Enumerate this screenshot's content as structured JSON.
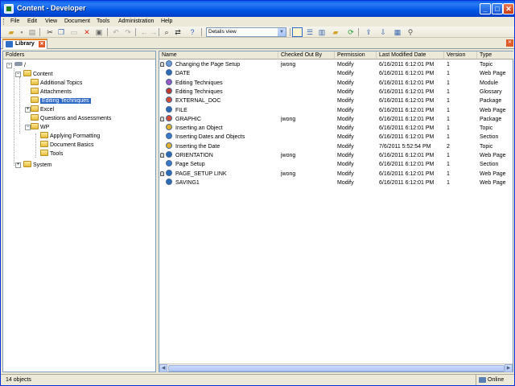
{
  "window": {
    "title": "Content - Developer",
    "minimize_glyph": "_",
    "maximize_glyph": "□",
    "close_glyph": "✕"
  },
  "menu": [
    "File",
    "Edit",
    "View",
    "Document",
    "Tools",
    "Administration",
    "Help"
  ],
  "toolbar": {
    "view_select_value": "Details view",
    "icons": [
      "open-folder-icon",
      "save-icon",
      "print-icon",
      "cut-icon",
      "copy-icon",
      "paste-icon",
      "delete-icon",
      "properties-icon",
      "undo-icon",
      "redo-icon",
      "back-icon",
      "forward-icon",
      "find-icon",
      "replace-icon",
      "help-icon",
      "details-view-icon",
      "list-view-icon",
      "split-view-icon",
      "new-folder-icon",
      "refresh-icon",
      "check-in-icon",
      "check-out-icon",
      "publish-icon",
      "link-icon"
    ]
  },
  "tab": {
    "label": "Library",
    "close_glyph": "✕"
  },
  "panel_close_glyph": "✕",
  "folders": {
    "header": "Folders",
    "root": "/",
    "items": [
      {
        "label": "Content",
        "level": 1,
        "expander": "−"
      },
      {
        "label": "Additional Topics",
        "level": 2,
        "expander": ""
      },
      {
        "label": "Attachments",
        "level": 2,
        "expander": ""
      },
      {
        "label": "Editing Techniques",
        "level": 2,
        "expander": "",
        "selected": true
      },
      {
        "label": "Excel",
        "level": 2,
        "expander": "+"
      },
      {
        "label": "Questions and Assessments",
        "level": 2,
        "expander": ""
      },
      {
        "label": "WP",
        "level": 2,
        "expander": "−"
      },
      {
        "label": "Applying Formatting",
        "level": 3,
        "expander": ""
      },
      {
        "label": "Document Basics",
        "level": 3,
        "expander": ""
      },
      {
        "label": "Tools",
        "level": 3,
        "expander": ""
      },
      {
        "label": "System",
        "level": 1,
        "expander": "+"
      }
    ]
  },
  "list": {
    "columns": [
      "Name",
      "Checked Out By",
      "Permission",
      "Last Modified Date",
      "Version",
      "Type"
    ],
    "rows": [
      {
        "locked": true,
        "icon": "topic-icon",
        "icon_color": "#6a9ad8",
        "name": "Changing the Page Setup",
        "checked_out_by": "jwong",
        "permission": "Modify",
        "modified": "6/16/2011 6:12:01 PM",
        "version": "1",
        "type": "Topic"
      },
      {
        "locked": false,
        "icon": "web-page-icon",
        "icon_color": "#2a6bb8",
        "name": "DATE",
        "checked_out_by": "",
        "permission": "Modify",
        "modified": "6/16/2011 6:12:01 PM",
        "version": "1",
        "type": "Web Page"
      },
      {
        "locked": false,
        "icon": "module-icon",
        "icon_color": "#9b59c6",
        "name": "Editing Techniques",
        "checked_out_by": "",
        "permission": "Modify",
        "modified": "6/16/2011 6:12:01 PM",
        "version": "1",
        "type": "Module"
      },
      {
        "locked": false,
        "icon": "glossary-icon",
        "icon_color": "#c0392b",
        "name": "Editing Techniques",
        "checked_out_by": "",
        "permission": "Modify",
        "modified": "6/16/2011 6:12:01 PM",
        "version": "1",
        "type": "Glossary"
      },
      {
        "locked": false,
        "icon": "package-icon",
        "icon_color": "#d04a3a",
        "name": "EXTERNAL_DOC",
        "checked_out_by": "",
        "permission": "Modify",
        "modified": "6/16/2011 6:12:01 PM",
        "version": "1",
        "type": "Package"
      },
      {
        "locked": false,
        "icon": "web-page-icon",
        "icon_color": "#2a6bb8",
        "name": "FILE",
        "checked_out_by": "",
        "permission": "Modify",
        "modified": "6/16/2011 6:12:01 PM",
        "version": "1",
        "type": "Web Page"
      },
      {
        "locked": true,
        "icon": "package-icon",
        "icon_color": "#d04a3a",
        "name": "GRAPHIC",
        "checked_out_by": "jwong",
        "permission": "Modify",
        "modified": "6/16/2011 6:12:01 PM",
        "version": "1",
        "type": "Package"
      },
      {
        "locked": false,
        "icon": "topic-icon",
        "icon_color": "#e0b030",
        "name": "Inserting an Object",
        "checked_out_by": "",
        "permission": "Modify",
        "modified": "6/16/2011 6:12:01 PM",
        "version": "1",
        "type": "Topic"
      },
      {
        "locked": false,
        "icon": "section-icon",
        "icon_color": "#3a78c8",
        "name": "Inserting Dates and Objects",
        "checked_out_by": "",
        "permission": "Modify",
        "modified": "6/16/2011 6:12:01 PM",
        "version": "1",
        "type": "Section"
      },
      {
        "locked": false,
        "icon": "topic-icon",
        "icon_color": "#e0b030",
        "name": "Inserting the Date",
        "checked_out_by": "",
        "permission": "Modify",
        "modified": "7/6/2011 5:52:54 PM",
        "version": "2",
        "type": "Topic"
      },
      {
        "locked": true,
        "icon": "web-page-icon",
        "icon_color": "#2a6bb8",
        "name": "ORIENTATION",
        "checked_out_by": "jwong",
        "permission": "Modify",
        "modified": "6/16/2011 6:12:01 PM",
        "version": "1",
        "type": "Web Page"
      },
      {
        "locked": false,
        "icon": "section-icon",
        "icon_color": "#3a78c8",
        "name": "Page Setup",
        "checked_out_by": "",
        "permission": "Modify",
        "modified": "6/16/2011 6:12:01 PM",
        "version": "1",
        "type": "Section"
      },
      {
        "locked": true,
        "icon": "web-page-icon",
        "icon_color": "#2a6bb8",
        "name": "PAGE_SETUP LINK",
        "checked_out_by": "jwong",
        "permission": "Modify",
        "modified": "6/16/2011 6:12:01 PM",
        "version": "1",
        "type": "Web Page"
      },
      {
        "locked": false,
        "icon": "web-page-icon",
        "icon_color": "#2a6bb8",
        "name": "SAVING1",
        "checked_out_by": "",
        "permission": "Modify",
        "modified": "6/16/2011 6:12:01 PM",
        "version": "1",
        "type": "Web Page"
      }
    ]
  },
  "status": {
    "count": "14 objects",
    "connection": "Online"
  }
}
